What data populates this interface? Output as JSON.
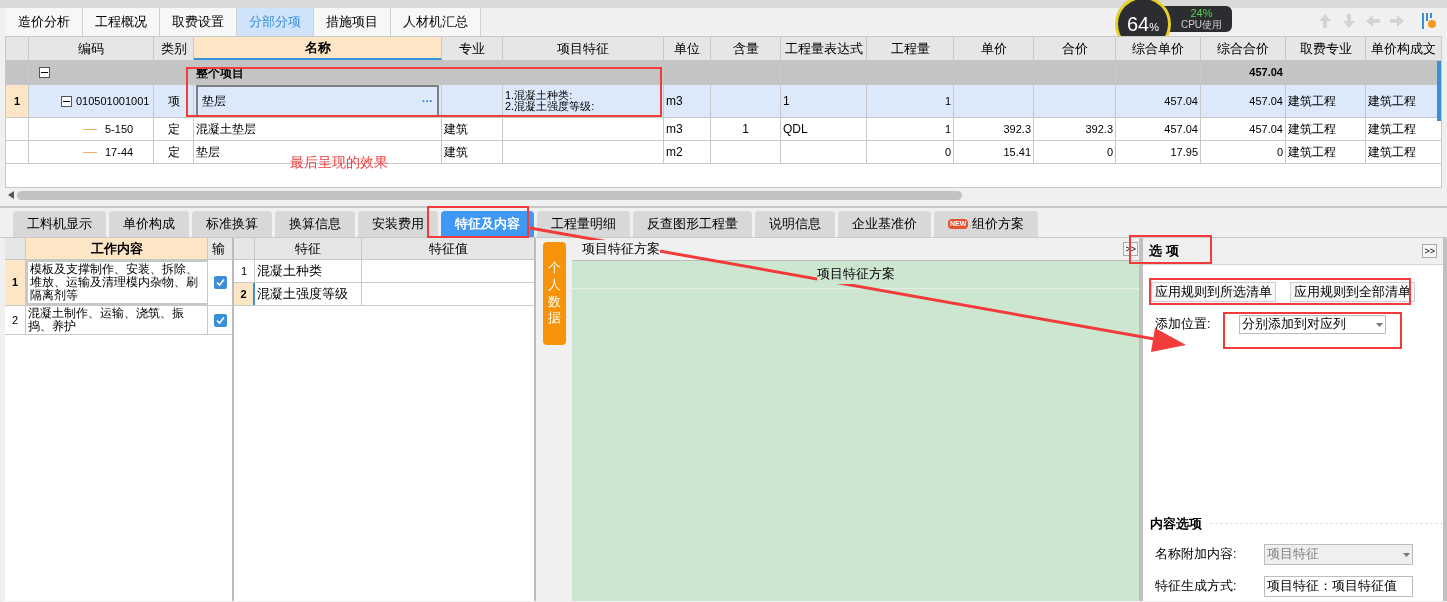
{
  "top_tabs": [
    {
      "label": "造价分析",
      "selected": false
    },
    {
      "label": "工程概况",
      "selected": false
    },
    {
      "label": "取费设置",
      "selected": false
    },
    {
      "label": "分部分项",
      "selected": true
    },
    {
      "label": "措施项目",
      "selected": false
    },
    {
      "label": "人材机汇总",
      "selected": false
    }
  ],
  "cpu": {
    "gauge": "64",
    "gauge_unit": "%",
    "usage": "24%",
    "label": "CPU使用"
  },
  "table": {
    "columns": [
      {
        "label": "编码",
        "selected": false
      },
      {
        "label": "类别",
        "selected": false
      },
      {
        "label": "名称",
        "selected": true
      },
      {
        "label": "专业",
        "selected": false
      },
      {
        "label": "项目特征",
        "selected": false
      },
      {
        "label": "单位",
        "selected": false
      },
      {
        "label": "含量",
        "selected": false
      },
      {
        "label": "工程量表达式",
        "selected": false
      },
      {
        "label": "工程量",
        "selected": false
      },
      {
        "label": "单价",
        "selected": false
      },
      {
        "label": "合价",
        "selected": false
      },
      {
        "label": "综合单价",
        "selected": false
      },
      {
        "label": "综合合价",
        "selected": false
      },
      {
        "label": "取费专业",
        "selected": false
      },
      {
        "label": "单价构成文",
        "selected": false
      }
    ],
    "rows": [
      {
        "kind": "group",
        "selected": false,
        "expanded": true,
        "name": "整个项目",
        "comp_total": "457.04",
        "children": [
          {
            "kind": "item",
            "number": "1",
            "selected": true,
            "expanded": true,
            "edit_button": "···",
            "code": "010501001001",
            "type": "项",
            "name": "垫层",
            "feature": [
              "1.混凝土种类:",
              "2.混凝土强度等级:"
            ],
            "unit": "m3",
            "expr": "1",
            "qty": "1",
            "comp_price": "457.04",
            "comp_total": "457.04",
            "fee_major": "建筑工程",
            "price_file": "建筑工程",
            "children": [
              {
                "kind": "quota",
                "selected": false,
                "code": "5-150",
                "type": "定",
                "name": "混凝土垫层",
                "major": "建筑",
                "unit": "m3",
                "content": "1",
                "expr": "QDL",
                "qty": "1",
                "price": "392.3",
                "total": "392.3",
                "comp_price": "457.04",
                "comp_total": "457.04",
                "fee_major": "建筑工程",
                "price_file": "建筑工程"
              },
              {
                "kind": "quota",
                "selected": false,
                "code": "17-44",
                "type": "定",
                "name": "垫层",
                "major": "建筑",
                "unit": "m2",
                "qty": "0",
                "price": "15.41",
                "total": "0",
                "comp_price": "17.95",
                "comp_total": "0",
                "fee_major": "建筑工程",
                "price_file": "建筑工程"
              }
            ]
          }
        ]
      }
    ]
  },
  "annotation": {
    "text": "最后呈现的效果"
  },
  "bottom_tabs": [
    {
      "label": "工料机显示",
      "selected": false
    },
    {
      "label": "单价构成",
      "selected": false
    },
    {
      "label": "标准换算",
      "selected": false
    },
    {
      "label": "换算信息",
      "selected": false
    },
    {
      "label": "安装费用",
      "selected": false
    },
    {
      "label": "特征及内容",
      "selected": true
    },
    {
      "label": "工程量明细",
      "selected": false
    },
    {
      "label": "反查图形工程量",
      "selected": false
    },
    {
      "label": "说明信息",
      "selected": false
    },
    {
      "label": "企业基准价",
      "selected": false
    },
    {
      "label": "组价方案",
      "selected": false,
      "badge": "NEW"
    }
  ],
  "work_table": {
    "columns": [
      "工作内容",
      "输"
    ],
    "rows": [
      {
        "number": "1",
        "selected": true,
        "text": "模板及支撑制作、安装、拆除、堆放、运输及清理模内杂物、刷隔离剂等",
        "checked": true
      },
      {
        "number": "2",
        "selected": false,
        "text": "混凝土制作、运输、浇筑、振捣、养护",
        "checked": true
      }
    ]
  },
  "feature_table": {
    "columns": [
      "特征",
      "特征值"
    ],
    "rows": [
      {
        "number": "1",
        "selected": false,
        "name": "混凝土种类"
      },
      {
        "number": "2",
        "selected": true,
        "name": "混凝土强度等级"
      }
    ]
  },
  "scheme_panel": {
    "side_tab": "个人数据",
    "title": "项目特征方案",
    "collapse": ">>",
    "grid_header": "项目特征方案"
  },
  "options_panel": {
    "title": "选 项",
    "collapse": ">>",
    "buttons": [
      "应用规则到所选清单",
      "应用规则到全部清单"
    ],
    "add_position": {
      "label": "添加位置:",
      "value": "分别添加到对应列"
    },
    "content_section": {
      "title": "内容选项",
      "fields": [
        {
          "label": "名称附加内容:",
          "value": "项目特征",
          "disabled": true
        },
        {
          "label": "特征生成方式:",
          "value": "项目特征：项目特征值",
          "disabled": false
        }
      ]
    }
  }
}
